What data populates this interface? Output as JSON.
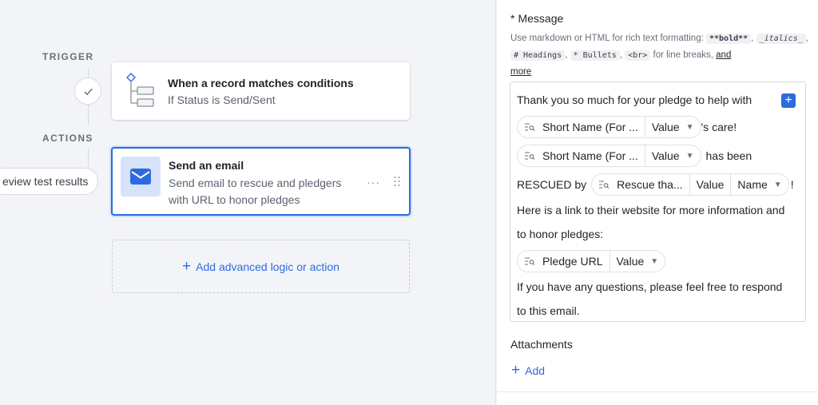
{
  "canvas": {
    "trigger_label": "TRIGGER",
    "actions_label": "ACTIONS",
    "review_pill": "eview test results",
    "trigger_card": {
      "title": "When a record matches conditions",
      "subtitle": "If Status is Send/Sent"
    },
    "action_card": {
      "title": "Send an email",
      "subtitle_line1": "Send email to rescue and pledgers",
      "subtitle_line2": "with URL to honor pledges",
      "more": "···"
    },
    "add_action": {
      "plus": "+",
      "label": "Add advanced logic or action"
    }
  },
  "panel": {
    "message": {
      "required_mark": "*",
      "label": "Message",
      "help": {
        "prefix": "Use markdown or HTML for rich text formatting:",
        "bold": "**bold**",
        "italics": "_italics_",
        "headings": "# Headings",
        "bullets": "* Bullets",
        "br": "<br>",
        "mid": "for line breaks,",
        "link1": "and",
        "link2": "more",
        "comma": ","
      },
      "insert_button": "+",
      "body": {
        "line1": "Thank you so much for your pledge to help with",
        "token1": {
          "field": "Short Name (For ...",
          "type": "Value"
        },
        "after1": "'s care!",
        "token2": {
          "field": "Short Name (For ...",
          "type": "Value"
        },
        "after2": "has been",
        "before3": "RESCUED by",
        "token3": {
          "field": "Rescue tha...",
          "type": "Value",
          "subtype": "Name"
        },
        "after3": "!",
        "line4": "Here is a link to their website for more information and",
        "line5": "to honor pledges:",
        "token4": {
          "field": "Pledge URL",
          "type": "Value"
        },
        "line6": "If you have any questions, please feel free to respond",
        "line7": "to this email."
      }
    },
    "attachments": {
      "label": "Attachments",
      "add_plus": "+",
      "add_label": "Add"
    }
  },
  "colors": {
    "accent": "#2d6ae0",
    "accent_tile": "#d6e3fb",
    "canvas_bg": "#f3f4f7"
  }
}
